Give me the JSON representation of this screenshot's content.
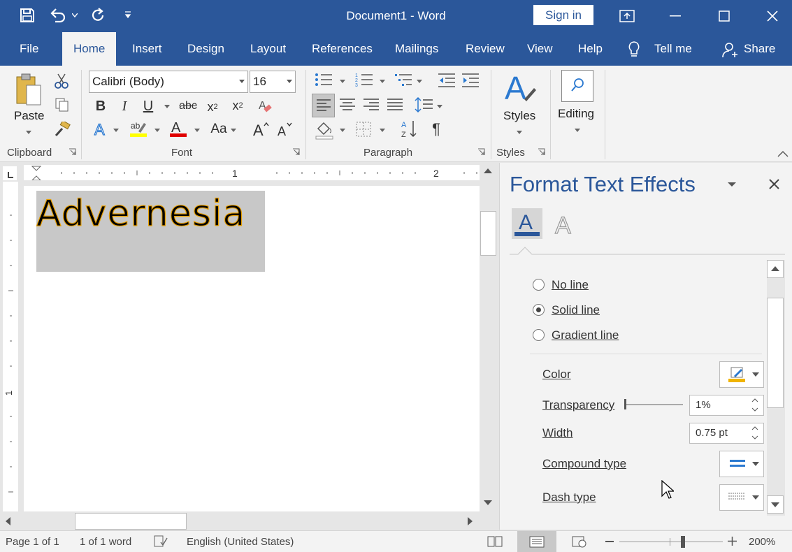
{
  "window": {
    "title": "Document1  -  Word",
    "sign_in": "Sign in"
  },
  "tabs": [
    "File",
    "Home",
    "Insert",
    "Design",
    "Layout",
    "References",
    "Mailings",
    "Review",
    "View",
    "Help"
  ],
  "tell_me": "Tell me",
  "share": "Share",
  "ribbon": {
    "clipboard": {
      "paste": "Paste",
      "label": "Clipboard"
    },
    "font": {
      "name": "Calibri (Body)",
      "size": "16",
      "label": "Font",
      "change_case": "Aa"
    },
    "paragraph": {
      "label": "Paragraph"
    },
    "styles": {
      "button": "Styles",
      "label": "Styles"
    },
    "editing": {
      "button": "Editing"
    }
  },
  "document": {
    "text": "Advernesia",
    "ruler_marks": [
      "1",
      "2"
    ],
    "vruler_mark": "1"
  },
  "pane": {
    "title": "Format Text Effects",
    "line_options": [
      {
        "label": "No line",
        "selected": false
      },
      {
        "label": "Solid line",
        "selected": true
      },
      {
        "label": "Gradient line",
        "selected": false
      }
    ],
    "color_label": "Color",
    "transparency_label": "Transparency",
    "transparency_value": "1%",
    "width_label": "Width",
    "width_value": "0.75 pt",
    "compound_label": "Compound type",
    "dash_label": "Dash type",
    "accent_color": "#2b579a",
    "line_color": "#f0b400"
  },
  "status": {
    "page": "Page 1 of 1",
    "words": "1 of 1 word",
    "language": "English (United States)",
    "zoom": "200%"
  }
}
